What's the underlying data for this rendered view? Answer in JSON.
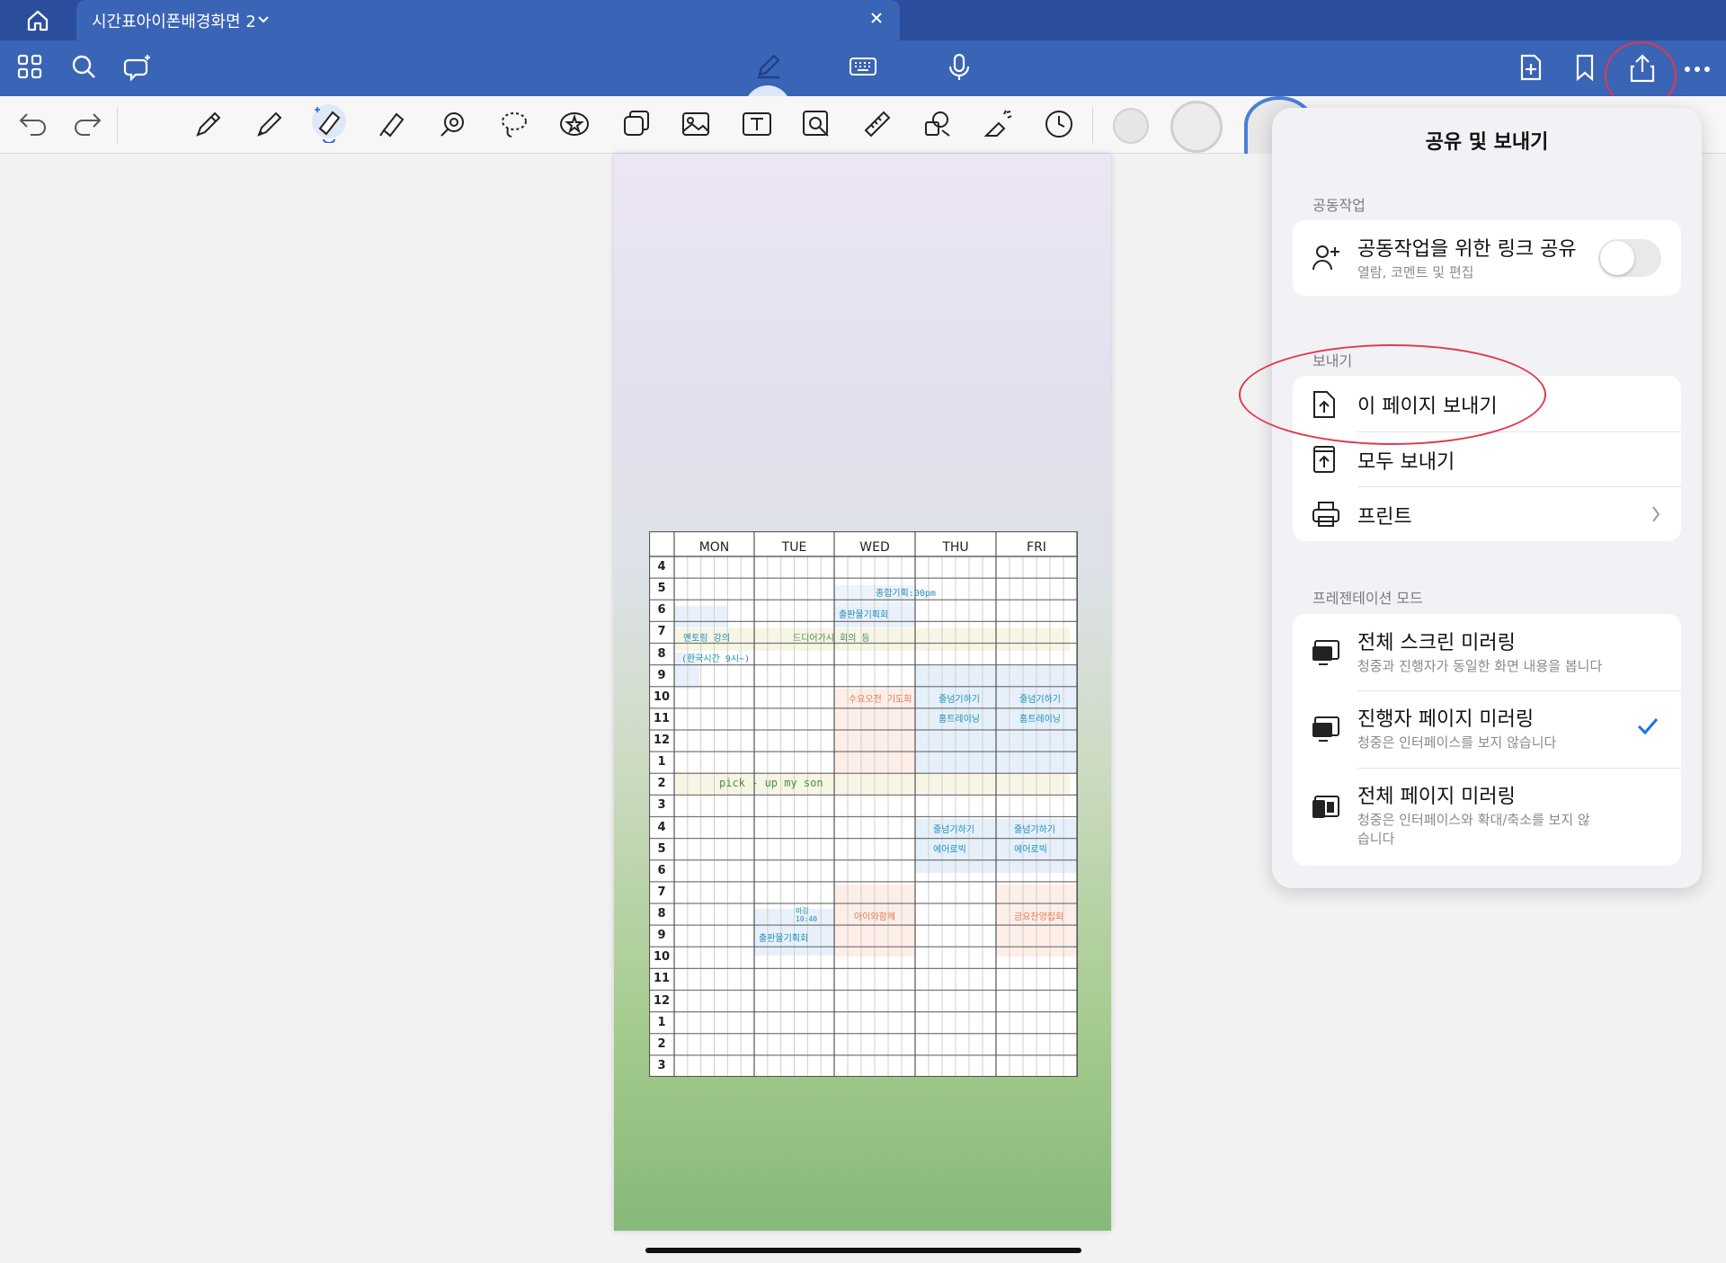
{
  "tab": {
    "title": "시간표아이폰배경화면 2"
  },
  "timetable": {
    "days": [
      "MON",
      "TUE",
      "WED",
      "THU",
      "FRI"
    ],
    "hours": [
      "4",
      "5",
      "6",
      "7",
      "8",
      "9",
      "10",
      "11",
      "12",
      "1",
      "2",
      "3",
      "4",
      "5",
      "6",
      "7",
      "8",
      "9",
      "10",
      "11",
      "12",
      "1",
      "2",
      "3"
    ],
    "notes": {
      "n1": "종합기획:00pm",
      "n2": "출판물기획회",
      "n3": "멘토링 강의",
      "n4": "드디어가시 회의 등",
      "n5": "(한국시간 9시~)",
      "n6": "수요오전 기도회",
      "n7": "줄넘기하기",
      "n8": "줄넘기하기",
      "n9": "홈트레이닝",
      "n10": "홈트레이닝",
      "n11": "pick - up  my  son",
      "n12": "줄넘기하기",
      "n13": "줄넘기하기",
      "n14": "에어로빅",
      "n15": "에어로빅",
      "n16": "마감\n10:40",
      "n17": "아이와함께",
      "n18": "금요찬양집회",
      "n19": "출판물기획회"
    }
  },
  "panel": {
    "title": "공유 및 보내기",
    "collab_section": "공동작업",
    "collab_title": "공동작업을 위한 링크 공유",
    "collab_sub": "열람, 코멘트 및 편집",
    "export_section": "보내기",
    "export_page": "이 페이지 보내기",
    "export_all": "모두 보내기",
    "print": "프린트",
    "present_section": "프레젠테이션 모드",
    "mirror_full_title": "전체 스크린 미러링",
    "mirror_full_sub": "청중과 진행자가 동일한 화면 내용을 봅니다",
    "mirror_presenter_title": "진행자 페이지 미러링",
    "mirror_presenter_sub": "청중은 인터페이스를 보지 않습니다",
    "mirror_page_title": "전체 페이지 미러링",
    "mirror_page_sub": "청중은 인터페이스와 확대/축소를 보지 않습니다"
  },
  "colors": {
    "toolbar": "#3a64b5",
    "titlebar": "#2b4e9c",
    "accent": "#1a73e8",
    "highlight_ring": "#e2384b"
  }
}
